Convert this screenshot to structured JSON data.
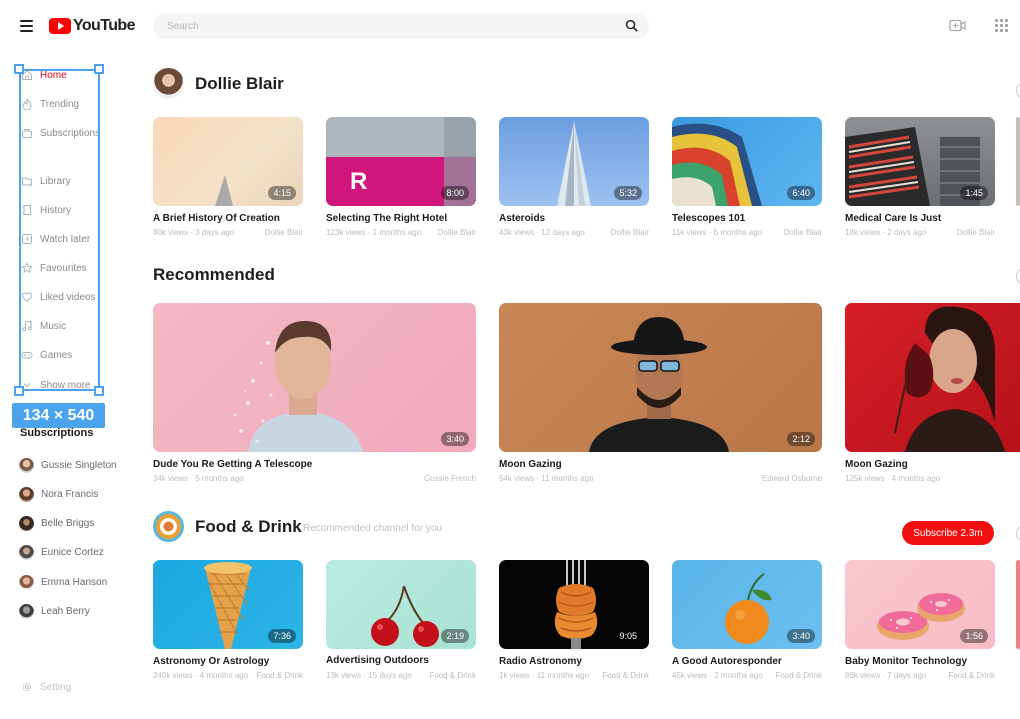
{
  "header": {
    "logo_text": "YouTube",
    "search_placeholder": "Search"
  },
  "sidebar": {
    "items": [
      {
        "label": "Home"
      },
      {
        "label": "Trending"
      },
      {
        "label": "Subscriptions"
      },
      {
        "label": "Library"
      },
      {
        "label": "History"
      },
      {
        "label": "Watch later"
      },
      {
        "label": "Favourites"
      },
      {
        "label": "Liked videos"
      },
      {
        "label": "Music"
      },
      {
        "label": "Games"
      },
      {
        "label": "Show more"
      }
    ],
    "subscriptions_title": "Subscriptions",
    "subscriptions": [
      {
        "name": "Gussie Singleton"
      },
      {
        "name": "Nora Francis"
      },
      {
        "name": "Belle Briggs"
      },
      {
        "name": "Eunice Cortez"
      },
      {
        "name": "Emma Hanson"
      },
      {
        "name": "Leah Berry"
      }
    ],
    "setting_label": "Setting"
  },
  "selection_label": "134 × 540",
  "sections": {
    "dollie": {
      "title": "Dollie Blair",
      "videos": [
        {
          "title": "A Brief History Of Creation",
          "meta": "80k views  ·  3 days ago",
          "channel": "Dollie Blair",
          "duration": "4:15"
        },
        {
          "title": "Selecting The Right Hotel",
          "meta": "123k views  ·  1 months ago",
          "channel": "Dollie Blair",
          "duration": "8:00"
        },
        {
          "title": "Asteroids",
          "meta": "43k views  ·  12 days ago",
          "channel": "Dollie Blair",
          "duration": "5:32"
        },
        {
          "title": "Telescopes 101",
          "meta": "11k views  ·  6 months ago",
          "channel": "Dollie Blair",
          "duration": "6:40"
        },
        {
          "title": "Medical Care Is Just",
          "meta": "18k views  ·  2 days ago",
          "channel": "Dollie Blair",
          "duration": "1:45"
        }
      ]
    },
    "recommended": {
      "title": "Recommended",
      "videos": [
        {
          "title": "Dude You Re Getting A Telescope",
          "meta": "34k views  ·  5 months ago",
          "channel": "Gussie French",
          "duration": "3:40"
        },
        {
          "title": "Moon Gazing",
          "meta": "54k views  ·  11 months ago",
          "channel": "Edward Osborne",
          "duration": "2:12"
        },
        {
          "title": "Moon Gazing",
          "meta": "125k views  ·  4 months ago",
          "channel": "",
          "duration": ""
        }
      ]
    },
    "food": {
      "title": "Food & Drink",
      "subtitle": "Recommended channel for you",
      "subscribe_label": "Subscribe 2.3m",
      "videos": [
        {
          "title": "Astronomy Or Astrology",
          "meta": "240k views  ·  4 months ago",
          "channel": "Food & Drink",
          "duration": "7:36"
        },
        {
          "title": "Advertising Outdoors",
          "meta": "13k views  ·  15 days ago",
          "channel": "Food & Drink",
          "duration": "2:19"
        },
        {
          "title": "Radio Astronomy",
          "meta": "1k views  ·  11 months ago",
          "channel": "Food & Drink",
          "duration": "9:05"
        },
        {
          "title": "A Good Autoresponder",
          "meta": "45k views  ·  2 months ago",
          "channel": "Food & Drink",
          "duration": "3:40"
        },
        {
          "title": "Baby Monitor Technology",
          "meta": "86k views  ·  7 days ago",
          "channel": "Food & Drink",
          "duration": "1:56"
        }
      ]
    }
  },
  "colors": {
    "accent": "#ff0000",
    "subscribe": "#f10f0f",
    "selection": "#4aa3ec"
  }
}
